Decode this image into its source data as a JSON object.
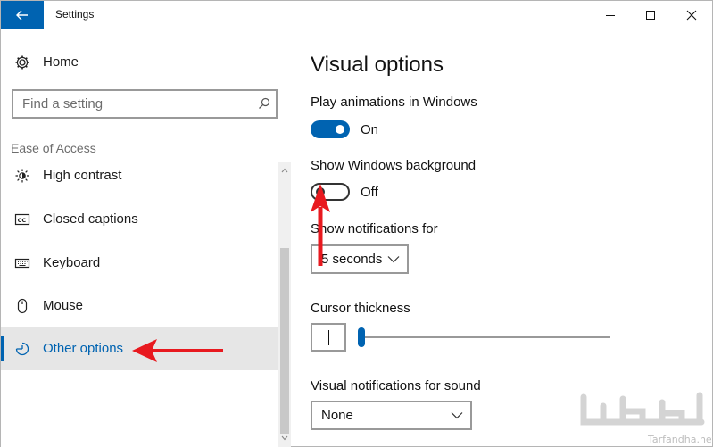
{
  "window": {
    "title": "Settings",
    "icons": {
      "back": "back-arrow-icon",
      "minimize": "minimize-icon",
      "maximize": "maximize-icon",
      "close": "close-icon"
    }
  },
  "sidebar": {
    "home_label": "Home",
    "search": {
      "placeholder": "Find a setting"
    },
    "section_title": "Ease of Access",
    "items": [
      {
        "label": "High contrast",
        "icon": "brightness-icon",
        "active": false
      },
      {
        "label": "Closed captions",
        "icon": "closed-captions-icon",
        "active": false
      },
      {
        "label": "Keyboard",
        "icon": "keyboard-icon",
        "active": false
      },
      {
        "label": "Mouse",
        "icon": "mouse-icon",
        "active": false
      },
      {
        "label": "Other options",
        "icon": "other-options-icon",
        "active": true
      }
    ]
  },
  "main": {
    "title": "Visual options",
    "animations": {
      "label": "Play animations in Windows",
      "state": "On",
      "on": true
    },
    "background": {
      "label": "Show Windows background",
      "state": "Off",
      "on": false
    },
    "notifications": {
      "label": "Show notifications for",
      "value": "5 seconds"
    },
    "cursor": {
      "label": "Cursor thickness",
      "level": 1
    },
    "sound": {
      "label": "Visual notifications for sound",
      "value": "None"
    }
  },
  "watermark": {
    "site": "Tarfandha.net"
  },
  "colors": {
    "accent": "#0063b1",
    "annotation": "#e8191f",
    "active_bg": "#e6e6e6"
  }
}
